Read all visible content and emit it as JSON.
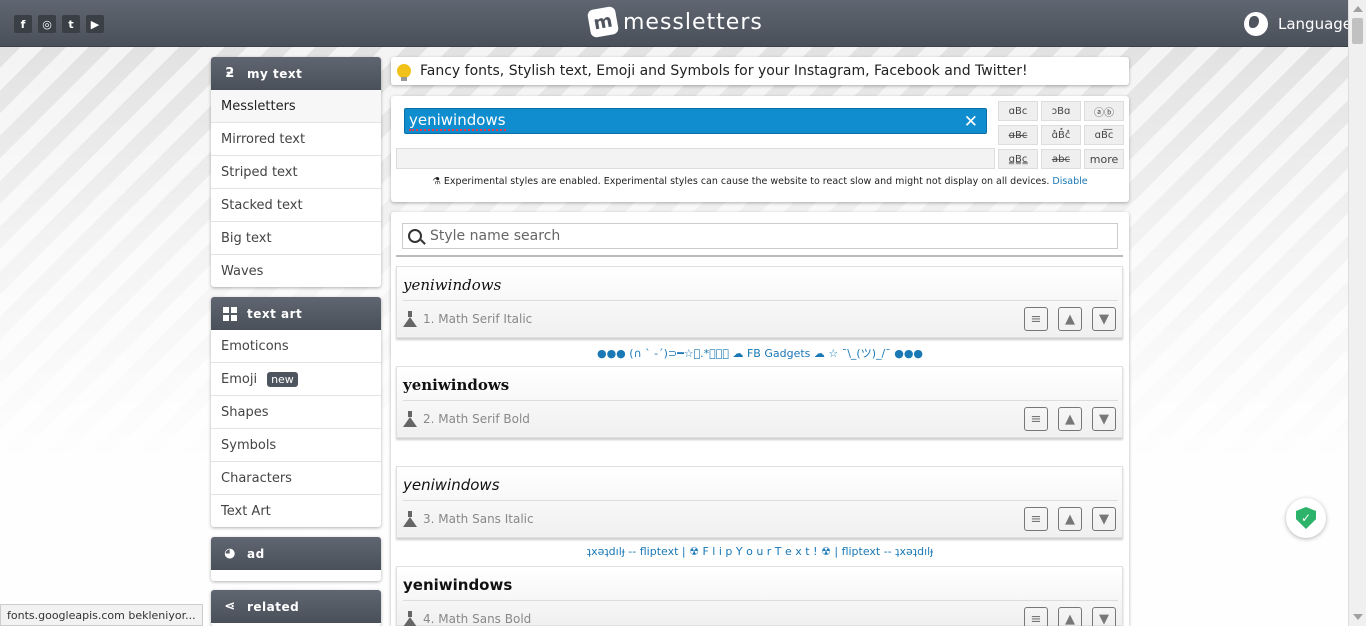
{
  "header": {
    "social": [
      "f",
      "◎",
      "t",
      "▶"
    ],
    "logo_text": "messletters",
    "language_label": "Language"
  },
  "sidebar": {
    "my_text": {
      "title": "my text",
      "items": [
        "Messletters",
        "Mirrored text",
        "Striped text",
        "Stacked text",
        "Big text",
        "Waves"
      ]
    },
    "text_art": {
      "title": "text art",
      "items": [
        "Emoticons",
        "Emoji",
        "Shapes",
        "Symbols",
        "Characters",
        "Text Art"
      ],
      "emoji_badge": "new"
    },
    "ad": {
      "title": "ad"
    },
    "related": {
      "title": "related"
    }
  },
  "banner": {
    "text": "Fancy fonts, Stylish text, Emoji and Symbols for your Instagram, Facebook and Twitter!"
  },
  "editor": {
    "input_value": "yeniwindows",
    "clear_icon": "✕",
    "style_buttons": [
      "ɑBc",
      "ɔBɑ",
      "ⓐⓑ",
      "ɑ̶B̶c̶",
      "ɑ̽B̽c̽",
      "ɑB͞c",
      "ɑ̳B̳c̳",
      "a̶b̶c̶",
      "more"
    ],
    "experimental_note": "Experimental styles are enabled. Experimental styles can cause the website to react slow and might not display on all devices.",
    "disable_link": "Disable"
  },
  "list": {
    "search_placeholder": "Style name search",
    "cards": [
      {
        "text": "yeniwindows",
        "label": "1. Math Serif Italic"
      },
      {
        "text": "yeniwindows",
        "label": "2. Math Serif Bold"
      },
      {
        "text": "yeniwindows",
        "label": "3. Math Sans Italic"
      },
      {
        "text": "yeniwindows",
        "label": "4. Math Sans Bold"
      }
    ],
    "promo1": "●●● (∩ ` -´)⊃━☆ﾟ.*･｡ﾟ ☁ FB Gadgets ☁ ☆ ¯\\_(ツ)_/¯ ●●●",
    "promo2": "ʇxǝʇdılɟ -- fliptext | ☢ F l i p Y o u r T e x t ! ☢ | fliptext -- ʇxǝʇdılɟ"
  },
  "status_text": "fonts.googleapis.com bekleniyor..."
}
